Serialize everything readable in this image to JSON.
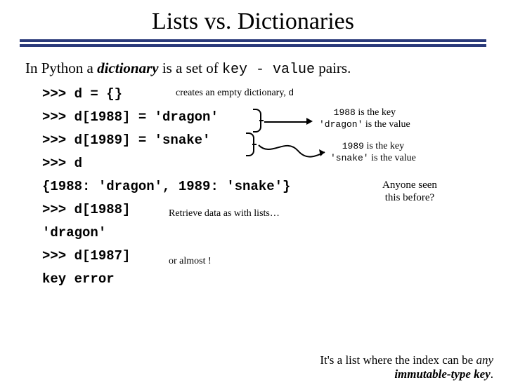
{
  "title": "Lists vs. Dictionaries",
  "intro": {
    "pre": "In Python a ",
    "term": "dictionary",
    "mid": " is a set of ",
    "kv": "key - value",
    "post": " pairs."
  },
  "code": {
    "l1": ">>> d = {}",
    "l2": ">>> d[1988] = 'dragon'",
    "l3": ">>> d[1989] = 'snake'",
    "l4": ">>> d",
    "l5": "{1988: 'dragon', 1989: 'snake'}",
    "l6": ">>> d[1988]",
    "l7": "'dragon'",
    "l8": ">>> d[1987]",
    "l9": "key error"
  },
  "ann": {
    "creates_pre": "creates an empty dictionary, ",
    "creates_var": "d",
    "kv1_a": "1988",
    "kv1_b": " is the key",
    "kv1_c": "'dragon'",
    "kv1_d": " is the value",
    "kv2_a": "1989",
    "kv2_b": " is the key",
    "kv2_c": "'snake'",
    "kv2_d": " is the value",
    "retrieve": "Retrieve data as with lists…",
    "almost": "or almost !",
    "seen1": "Anyone seen",
    "seen2": "this before?"
  },
  "footer": {
    "a": "It's a list where the index can be ",
    "any": "any",
    "b": " ",
    "imt": "immutable-type key",
    "c": "."
  }
}
